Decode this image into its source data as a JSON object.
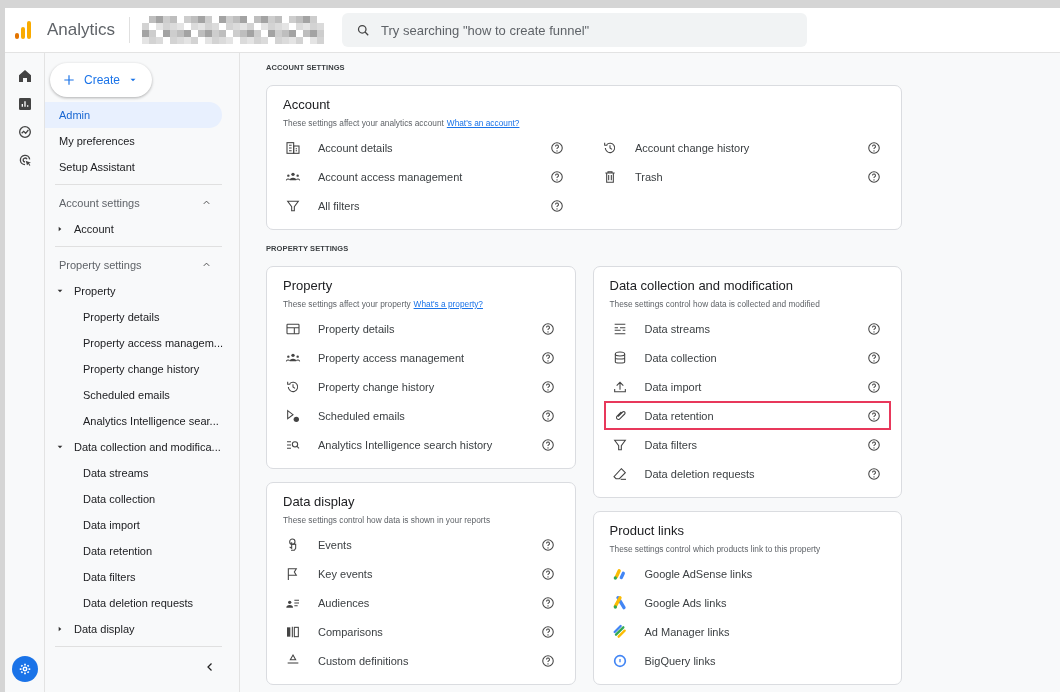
{
  "header": {
    "product": "Analytics",
    "search": {
      "placeholder": "Try searching \"how to create funnel\""
    }
  },
  "create_button": {
    "label": "Create"
  },
  "sidebar": {
    "top_items": [
      {
        "label": "Admin",
        "selected": true
      },
      {
        "label": "My preferences",
        "selected": false
      },
      {
        "label": "Setup Assistant",
        "selected": false
      }
    ],
    "sections": [
      {
        "title": "Account settings",
        "expanded": true,
        "items": [
          {
            "label": "Account",
            "expanded": false
          }
        ]
      },
      {
        "title": "Property settings",
        "expanded": true,
        "items": [
          {
            "label": "Property",
            "expanded": true,
            "children": [
              {
                "label": "Property details"
              },
              {
                "label": "Property access managem..."
              },
              {
                "label": "Property change history"
              },
              {
                "label": "Scheduled emails"
              },
              {
                "label": "Analytics Intelligence sear..."
              }
            ]
          },
          {
            "label": "Data collection and modifica...",
            "expanded": true,
            "children": [
              {
                "label": "Data streams"
              },
              {
                "label": "Data collection"
              },
              {
                "label": "Data import"
              },
              {
                "label": "Data retention"
              },
              {
                "label": "Data filters"
              },
              {
                "label": "Data deletion requests"
              }
            ]
          },
          {
            "label": "Data display",
            "expanded": false
          }
        ]
      }
    ]
  },
  "sections": [
    {
      "heading": "ACCOUNT SETTINGS",
      "columns": [
        [
          {
            "title": "Account",
            "description": "These settings affect your analytics account",
            "link": "What's an account?",
            "help": true,
            "item_columns": [
              [
                {
                  "label": "Account details"
                },
                {
                  "label": "Account access management"
                },
                {
                  "label": "All filters"
                }
              ],
              [
                {
                  "label": "Account change history"
                },
                {
                  "label": "Trash"
                }
              ]
            ]
          }
        ]
      ]
    },
    {
      "heading": "PROPERTY SETTINGS",
      "columns": [
        [
          {
            "title": "Property",
            "description": "These settings affect your property",
            "link": "What's a property?",
            "help": true,
            "item_columns": [
              [
                {
                  "label": "Property details"
                },
                {
                  "label": "Property access management"
                },
                {
                  "label": "Property change history"
                },
                {
                  "label": "Scheduled emails"
                },
                {
                  "label": "Analytics Intelligence search history"
                }
              ]
            ]
          },
          {
            "title": "Data display",
            "description": "These settings control how data is shown in your reports",
            "help": true,
            "item_columns": [
              [
                {
                  "label": "Events"
                },
                {
                  "label": "Key events"
                },
                {
                  "label": "Audiences"
                },
                {
                  "label": "Comparisons"
                },
                {
                  "label": "Custom definitions"
                }
              ]
            ]
          }
        ],
        [
          {
            "title": "Data collection and modification",
            "description": "These settings control how data is collected and modified",
            "help": true,
            "item_columns": [
              [
                {
                  "label": "Data streams",
                  "highlighted": false
                },
                {
                  "label": "Data collection",
                  "highlighted": false
                },
                {
                  "label": "Data import",
                  "highlighted": false
                },
                {
                  "label": "Data retention",
                  "highlighted": true
                },
                {
                  "label": "Data filters",
                  "highlighted": false
                },
                {
                  "label": "Data deletion requests",
                  "highlighted": false
                }
              ]
            ]
          },
          {
            "title": "Product links",
            "description": "These settings control which products link to this property",
            "help": false,
            "item_columns": [
              [
                {
                  "label": "Google AdSense links"
                },
                {
                  "label": "Google Ads links"
                },
                {
                  "label": "Ad Manager links"
                },
                {
                  "label": "BigQuery links"
                }
              ]
            ]
          }
        ]
      ]
    }
  ]
}
